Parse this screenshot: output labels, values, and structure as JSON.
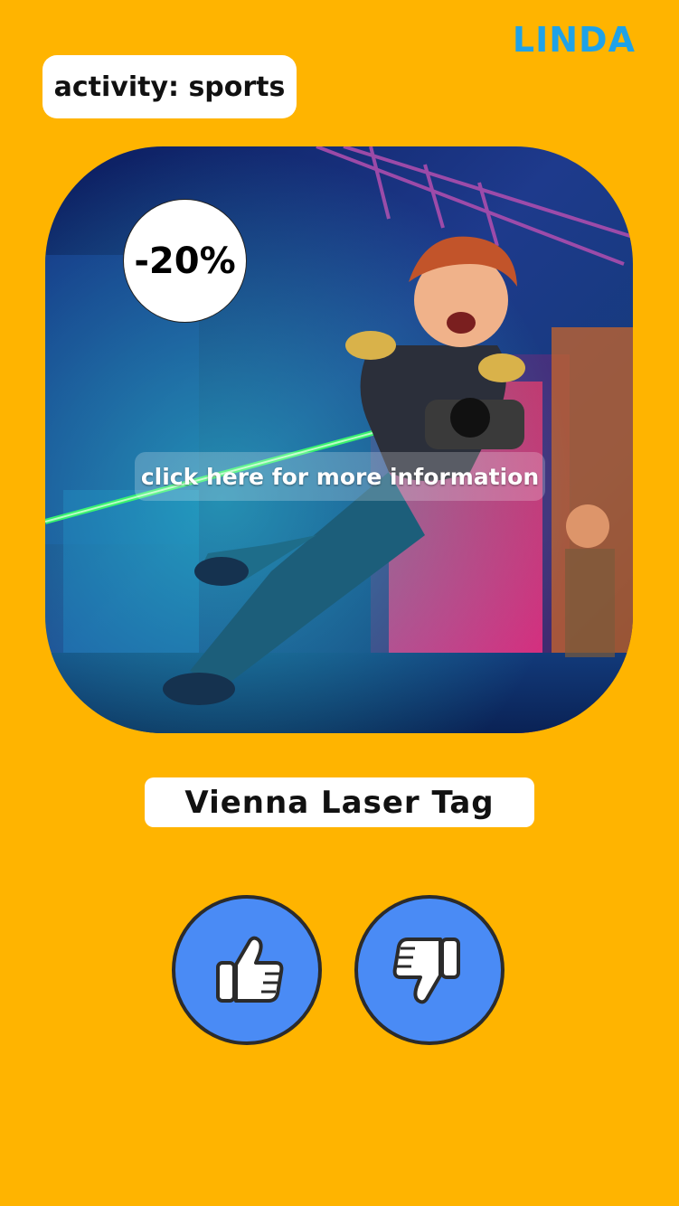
{
  "header": {
    "brand": "LINDA"
  },
  "category": {
    "label": "activity: sports"
  },
  "offer": {
    "discount": "-20%",
    "info_link": "click here for more information",
    "image_alt": "Boy leaping with a laser tag gun in a neon-lit arena"
  },
  "title": "Vienna Laser Tag",
  "actions": {
    "like_icon": "thumbs-up-icon",
    "dislike_icon": "thumbs-down-icon"
  },
  "colors": {
    "background": "#FFB400",
    "brand": "#1FA2E8",
    "button": "#4A8BF5"
  }
}
